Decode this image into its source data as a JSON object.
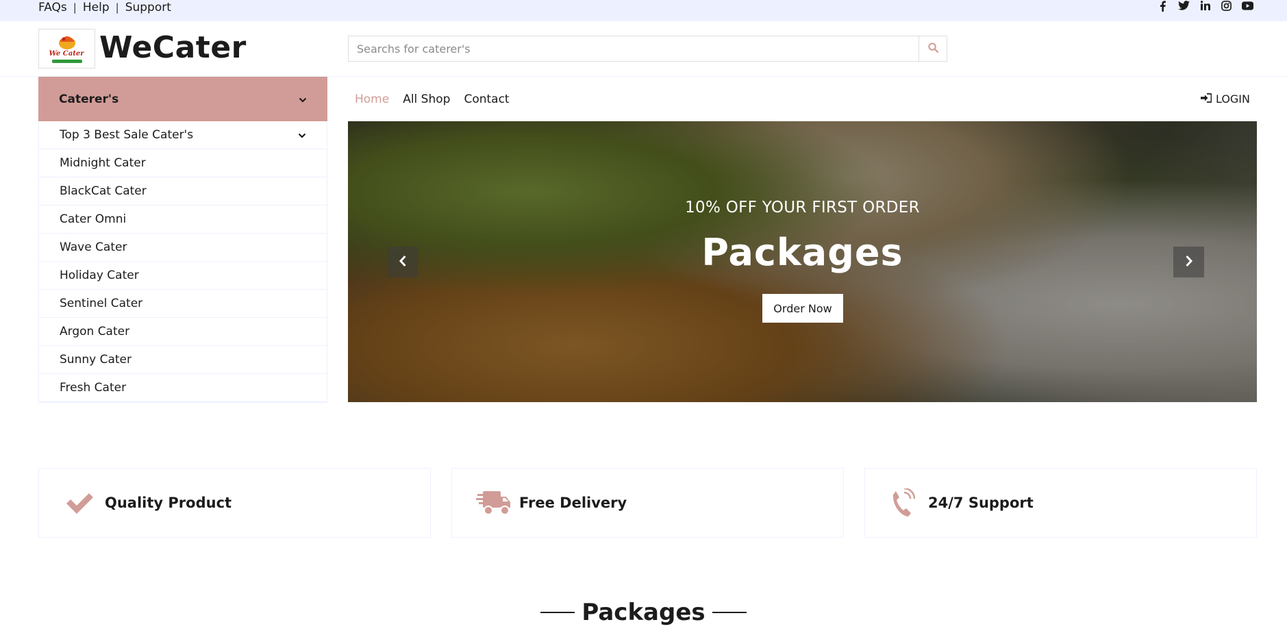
{
  "topbar": {
    "links": [
      "FAQs",
      "Help",
      "Support"
    ],
    "separator": "|",
    "social": [
      "facebook-icon",
      "twitter-icon",
      "linkedin-icon",
      "instagram-icon",
      "youtube-icon"
    ]
  },
  "header": {
    "brand": "WeCater",
    "logo_text": "We Cater",
    "search_placeholder": "Searchs for caterer's"
  },
  "sidebar": {
    "title": "Caterer's",
    "items": [
      {
        "label": "Top 3 Best Sale Cater's",
        "has_dropdown": true
      },
      {
        "label": "Midnight Cater"
      },
      {
        "label": "BlackCat Cater"
      },
      {
        "label": "Cater Omni"
      },
      {
        "label": "Wave Cater"
      },
      {
        "label": "Holiday Cater"
      },
      {
        "label": "Sentinel Cater"
      },
      {
        "label": "Argon Cater"
      },
      {
        "label": "Sunny Cater"
      },
      {
        "label": "Fresh Cater"
      }
    ]
  },
  "nav": {
    "links": [
      "Home",
      "All Shop",
      "Contact"
    ],
    "active": "Home",
    "login_label": "LOGIN"
  },
  "hero": {
    "subtitle": "10% OFF YOUR FIRST ORDER",
    "title": "Packages",
    "button_label": "Order Now"
  },
  "features": [
    {
      "label": "Quality Product",
      "icon": "check-icon"
    },
    {
      "label": "Free Delivery",
      "icon": "shipping-truck-icon"
    },
    {
      "label": "24/7 Support",
      "icon": "phone-icon"
    }
  ],
  "section": {
    "title": "Packages"
  },
  "colors": {
    "accent": "#d19c97",
    "topbar_bg": "#edf1ff",
    "text": "#1c1c1c"
  }
}
